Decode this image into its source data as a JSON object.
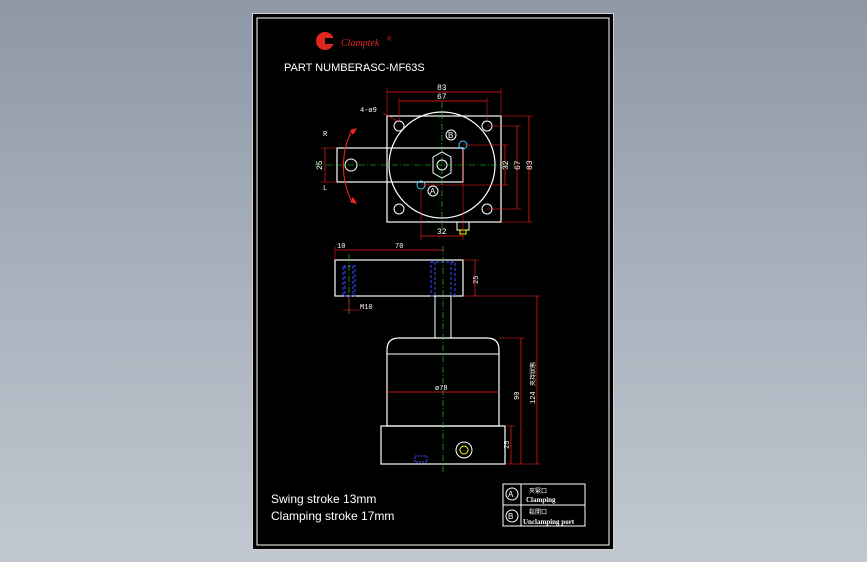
{
  "brand": {
    "name": "Clamptek",
    "mark": "®",
    "logo_color": "#e0261d"
  },
  "title": {
    "label": "PART NUMBER:",
    "value": "ASC-MF63S"
  },
  "top_view": {
    "dims": {
      "w83": "83",
      "w67": "67",
      "h83": "83",
      "h67": "67",
      "d32v": "32",
      "d25": "25",
      "d32h": "32"
    },
    "hole_note": "4-ø9",
    "r_label": "R",
    "l_label": "L",
    "port_a": "A",
    "port_b": "B"
  },
  "side_view": {
    "dims": {
      "d10": "10",
      "d70": "70",
      "d25a": "25",
      "m10": "M10",
      "dia78": "ø78",
      "d90": "90",
      "d124": "124",
      "d124_note": "夾持狀態",
      "d25b": "25"
    }
  },
  "notes": {
    "swing": "Swing stroke 13mm",
    "clamping": "Clamping stroke 17mm"
  },
  "legend": [
    {
      "symbol": "A",
      "cn": "夾緊口",
      "en": "Clamping"
    },
    {
      "symbol": "B",
      "cn": "鬆開口",
      "en": "Unclamping port"
    }
  ],
  "colors": {
    "outline": "#ffffff",
    "dimension": "#ff2020",
    "center": "#1ee61e",
    "hidden": "#3a4bff",
    "port": "#35d0ff",
    "yellow": "#ffff00"
  }
}
